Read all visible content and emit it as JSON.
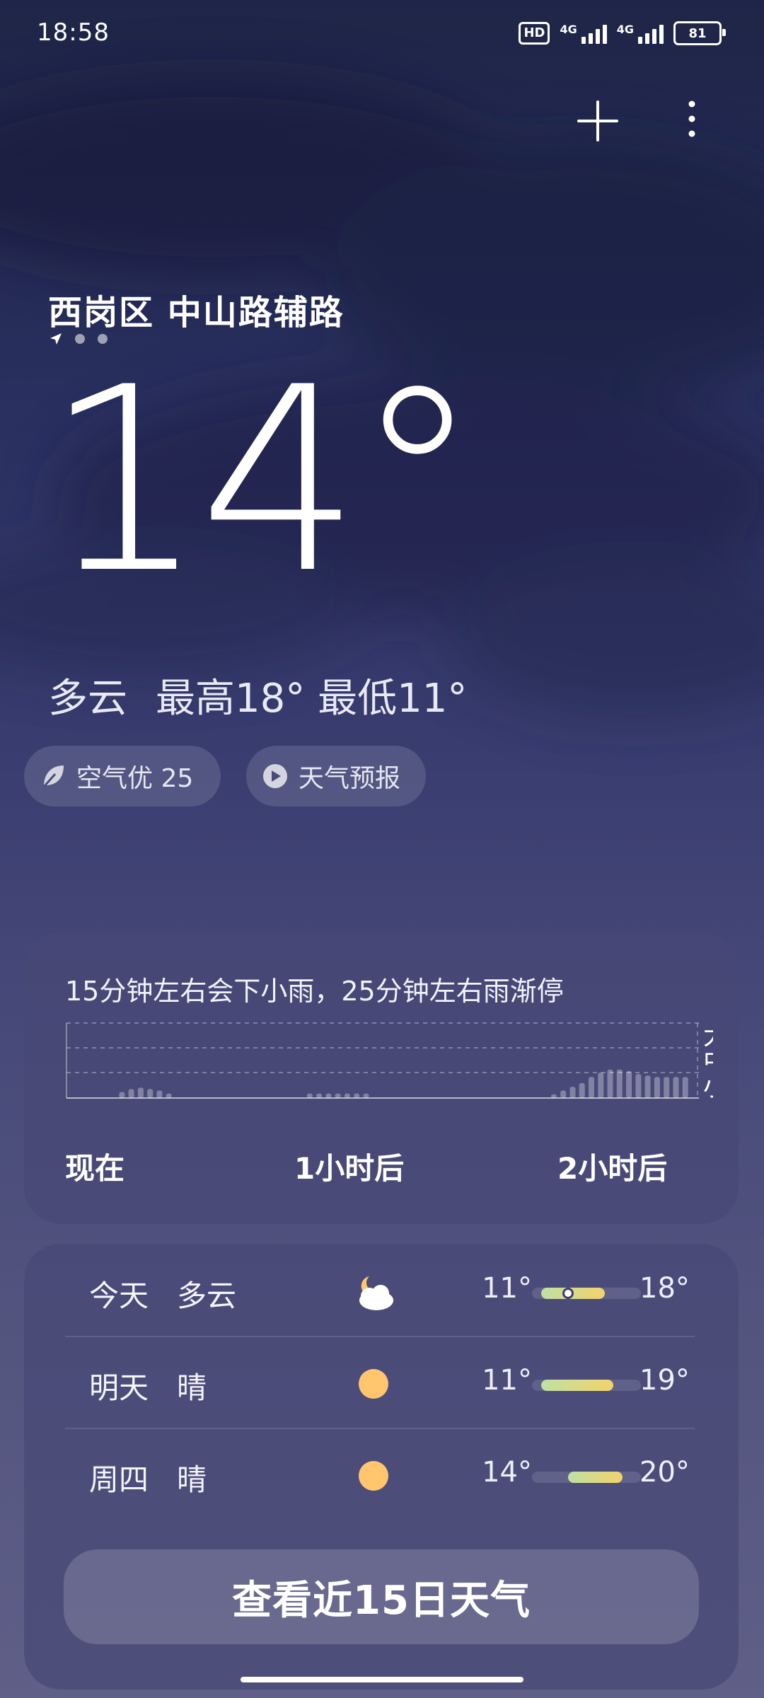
{
  "status_bar": {
    "time": "18:58",
    "hd": "HD",
    "network_1": "4G",
    "network_2": "4G",
    "battery": "81"
  },
  "header": {
    "add_icon": "plus-icon",
    "menu_icon": "more-vertical-icon"
  },
  "location": {
    "name": "西岗区 中山路辅路",
    "page_count": 3,
    "current_page": 1
  },
  "current": {
    "temperature": "14°",
    "condition": "多云",
    "high": "最高18°",
    "low": "最低11°"
  },
  "chips": {
    "air_quality": "空气优 25",
    "forecast_video": "天气预报"
  },
  "rain": {
    "message": "15分钟左右会下小雨，25分钟左右雨渐停",
    "levels": [
      "大",
      "中",
      "小"
    ],
    "time_labels": [
      "现在",
      "1小时后",
      "2小时后"
    ],
    "intensity": [
      0,
      0,
      0,
      0,
      0,
      0.08,
      0.12,
      0.14,
      0.12,
      0.1,
      0.06,
      0,
      0,
      0,
      0,
      0,
      0,
      0,
      0,
      0,
      0,
      0,
      0,
      0,
      0,
      0.06,
      0.06,
      0.06,
      0.06,
      0.06,
      0.06,
      0.06,
      0,
      0,
      0,
      0,
      0,
      0,
      0,
      0,
      0,
      0,
      0,
      0,
      0,
      0,
      0,
      0,
      0,
      0,
      0,
      0.05,
      0.1,
      0.15,
      0.2,
      0.28,
      0.34,
      0.38,
      0.38,
      0.36,
      0.32,
      0.3,
      0.28,
      0.28,
      0.28,
      0.28
    ]
  },
  "forecast": {
    "days": [
      {
        "day": "今天",
        "condition": "多云",
        "icon": "partly-cloudy-night-icon",
        "low": "11°",
        "high": "18°",
        "low_val": 11,
        "high_val": 18,
        "current_val": 14
      },
      {
        "day": "明天",
        "condition": "晴",
        "icon": "sun-icon",
        "low": "11°",
        "high": "19°",
        "low_val": 11,
        "high_val": 19
      },
      {
        "day": "周四",
        "condition": "晴",
        "icon": "sun-icon",
        "low": "14°",
        "high": "20°",
        "low_val": 14,
        "high_val": 20
      }
    ],
    "range_min": 10,
    "range_max": 22,
    "button_label": "查看近15日天气"
  },
  "colors": {
    "cool": "#bfe0a4",
    "warm": "#f2d36b",
    "sun": "#ffc66e",
    "cloud": "#ffffff"
  }
}
